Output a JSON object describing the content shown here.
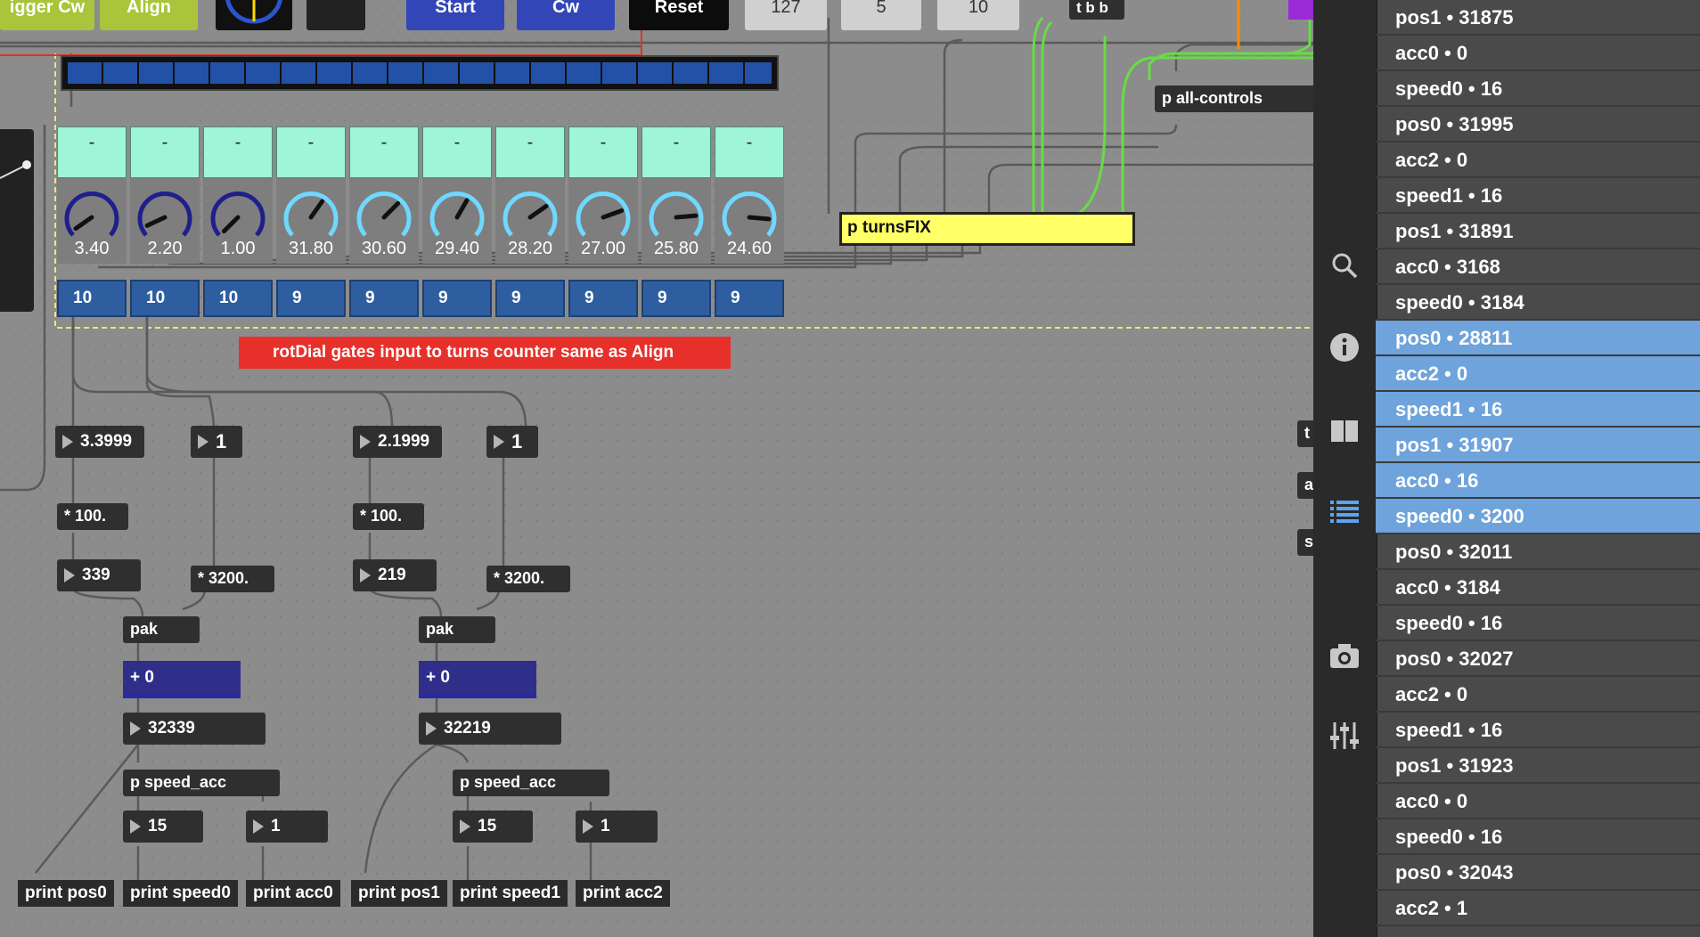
{
  "top_buttons": [
    "igger Cw",
    "Align",
    "Start",
    "Cw",
    "Reset"
  ],
  "top_numbers": [
    "127",
    "5",
    "10"
  ],
  "tbb": "t b b",
  "all_controls": "p all-controls",
  "turnsfix": "p turnsFIX",
  "teal_labels": [
    "-",
    "-",
    "-",
    "-",
    "-",
    "-",
    "-",
    "-",
    "-",
    "-"
  ],
  "dial_values": [
    "3.40",
    "2.20",
    "1.00",
    "31.80",
    "30.60",
    "29.40",
    "28.20",
    "27.00",
    "25.80",
    "24.60"
  ],
  "dial_colors": [
    "#1f1f8c",
    "#1f1f8c",
    "#1f1f8c",
    "#6fd8ff",
    "#6fd8ff",
    "#6fd8ff",
    "#6fd8ff",
    "#6fd8ff",
    "#6fd8ff",
    "#6fd8ff"
  ],
  "turns_values": [
    "10",
    "10",
    "10",
    "9",
    "9",
    "9",
    "9",
    "9",
    "9",
    "9"
  ],
  "comment": "rotDial gates input to turns counter same as Align",
  "left_chain": {
    "float_a": "3.3999",
    "int_a": "1",
    "mult100": "* 100.",
    "val_a": "339",
    "mult3200": "* 3200.",
    "pak": "pak",
    "plus": "+ 0",
    "sum": "32339",
    "speed_acc": "p speed_acc",
    "speed": "15",
    "acc": "1"
  },
  "right_chain": {
    "float_a": "2.1999",
    "int_a": "1",
    "mult100": "* 100.",
    "val_a": "219",
    "mult3200": "* 3200.",
    "pak": "pak",
    "plus": "+ 0",
    "sum": "32219",
    "speed_acc": "p speed_acc",
    "speed": "15",
    "acc": "1"
  },
  "prints": [
    "print pos0",
    "print speed0",
    "print acc0",
    "print pos1",
    "print speed1",
    "print acc2"
  ],
  "side_objs": [
    "t",
    "a",
    "s"
  ],
  "console": [
    {
      "text": "pos1 • 31875",
      "sel": false
    },
    {
      "text": "acc0 • 0",
      "sel": false
    },
    {
      "text": "speed0 • 16",
      "sel": false
    },
    {
      "text": "pos0 • 31995",
      "sel": false
    },
    {
      "text": "acc2 • 0",
      "sel": false
    },
    {
      "text": "speed1 • 16",
      "sel": false
    },
    {
      "text": "pos1 • 31891",
      "sel": false
    },
    {
      "text": "acc0 • 3168",
      "sel": false
    },
    {
      "text": "speed0 • 3184",
      "sel": false
    },
    {
      "text": "pos0 • 28811",
      "sel": true
    },
    {
      "text": "acc2 • 0",
      "sel": true
    },
    {
      "text": "speed1 • 16",
      "sel": true
    },
    {
      "text": "pos1 • 31907",
      "sel": true
    },
    {
      "text": "acc0 • 16",
      "sel": true
    },
    {
      "text": "speed0 • 3200",
      "sel": true
    },
    {
      "text": "pos0 • 32011",
      "sel": false
    },
    {
      "text": "acc0 • 3184",
      "sel": false
    },
    {
      "text": "speed0 • 16",
      "sel": false
    },
    {
      "text": "pos0 • 32027",
      "sel": false
    },
    {
      "text": "acc2 • 0",
      "sel": false
    },
    {
      "text": "speed1 • 16",
      "sel": false
    },
    {
      "text": "pos1 • 31923",
      "sel": false
    },
    {
      "text": "acc0 • 0",
      "sel": false
    },
    {
      "text": "speed0 • 16",
      "sel": false
    },
    {
      "text": "pos0 • 32043",
      "sel": false
    },
    {
      "text": "acc2 • 1",
      "sel": false
    }
  ],
  "sidebar_icons": [
    "search-icon",
    "info-icon",
    "book-icon",
    "list-icon",
    "camera-icon",
    "sliders-icon"
  ],
  "colors": {
    "accent_selected": "#6ea3db",
    "comment_bg": "#e8302a",
    "turnsfix_bg": "#ffff66",
    "teal": "#9ef5d8"
  }
}
